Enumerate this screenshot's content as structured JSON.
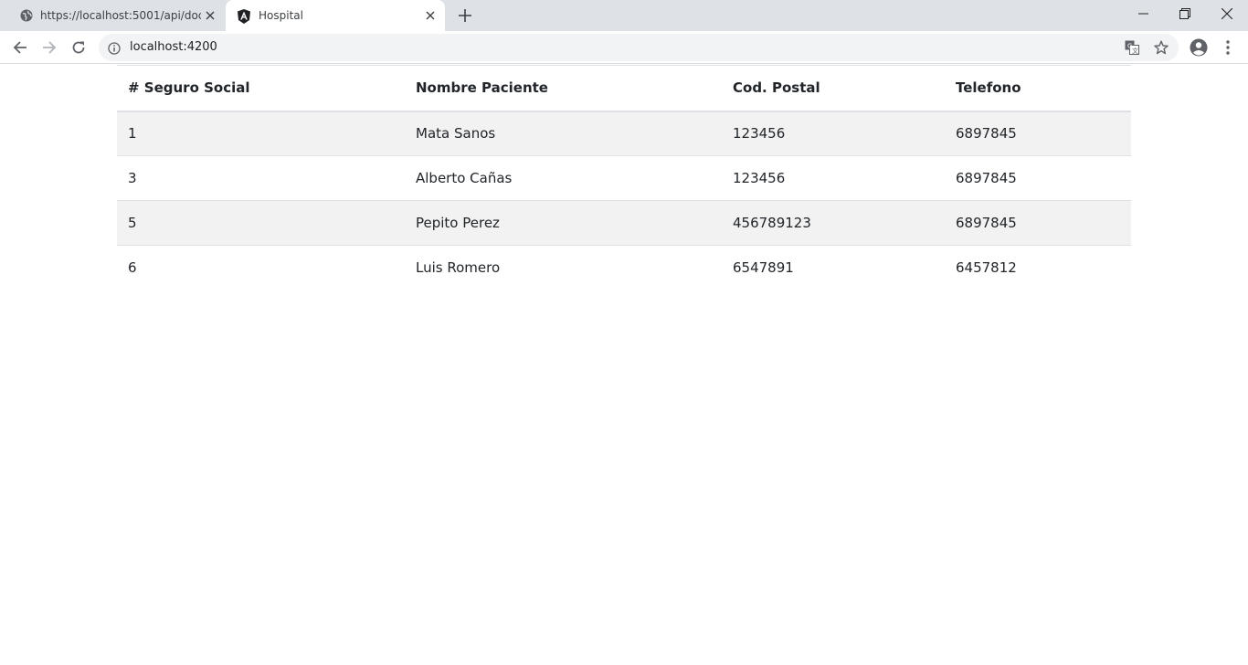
{
  "browser": {
    "tabs": [
      {
        "title": "https://localhost:5001/api/doctor",
        "favicon": "globe-icon",
        "active": false
      },
      {
        "title": "Hospital",
        "favicon": "angular-icon",
        "active": true
      }
    ],
    "address_bar": {
      "url": "localhost:4200"
    }
  },
  "table": {
    "headers": [
      "# Seguro Social",
      "Nombre Paciente",
      "Cod. Postal",
      "Telefono"
    ],
    "rows": [
      {
        "seguro_social": "1",
        "nombre": "Mata Sanos",
        "cod_postal": "123456",
        "telefono": "6897845"
      },
      {
        "seguro_social": "3",
        "nombre": "Alberto Cañas",
        "cod_postal": "123456",
        "telefono": "6897845"
      },
      {
        "seguro_social": "5",
        "nombre": "Pepito Perez",
        "cod_postal": "456789123",
        "telefono": "6897845"
      },
      {
        "seguro_social": "6",
        "nombre": "Luis Romero",
        "cod_postal": "6547891",
        "telefono": "6457812"
      }
    ]
  },
  "colors": {
    "tabstrip": "#dee1e6",
    "striped_row": "#f2f2f2",
    "border": "#dee2e6",
    "text": "#212529"
  }
}
